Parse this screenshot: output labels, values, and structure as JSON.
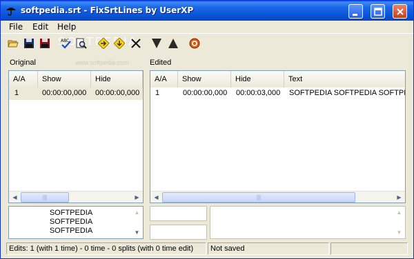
{
  "window": {
    "title": "softpedia.srt - FixSrtLines by UserXP"
  },
  "menu": {
    "items": [
      "File",
      "Edit",
      "Help"
    ]
  },
  "toolbar": {
    "tools": [
      "open-folder-icon",
      "save-icon",
      "save-as-icon",
      "spell-check-icon",
      "print-preview-icon",
      "move-next-icon",
      "move-down-icon",
      "delete-icon",
      "merge-down-icon",
      "split-up-icon",
      "about-icon"
    ],
    "watermark": "SOFTPEDIA",
    "watermark_url": "www.softpedia.com"
  },
  "original": {
    "label": "Original",
    "columns": [
      "A/A",
      "Show",
      "Hide"
    ],
    "rows": [
      {
        "aa": "1",
        "show": "00:00:00,000",
        "hide": "00:00:00,000"
      }
    ],
    "memo_lines": [
      "SOFTPEDIA",
      "SOFTPEDIA",
      "SOFTPEDIA"
    ]
  },
  "edited": {
    "label": "Edited",
    "columns": [
      "A/A",
      "Show",
      "Hide",
      "Text"
    ],
    "rows": [
      {
        "aa": "1",
        "show": "00:00:00,000",
        "hide": "00:00:03,000",
        "text": "SOFTPEDIA SOFTPEDIA SOFTPEDIA"
      }
    ]
  },
  "statusbar": {
    "edits": "Edits: 1 (with 1 time) - 0 time - 0 splits (with 0 time edit)",
    "saved": "Not saved",
    "extra": ""
  },
  "colors": {
    "titlebar": "#0b55d8",
    "face": "#ece9d8",
    "border": "#7f9db9",
    "selected_row": "#ece9d8"
  }
}
